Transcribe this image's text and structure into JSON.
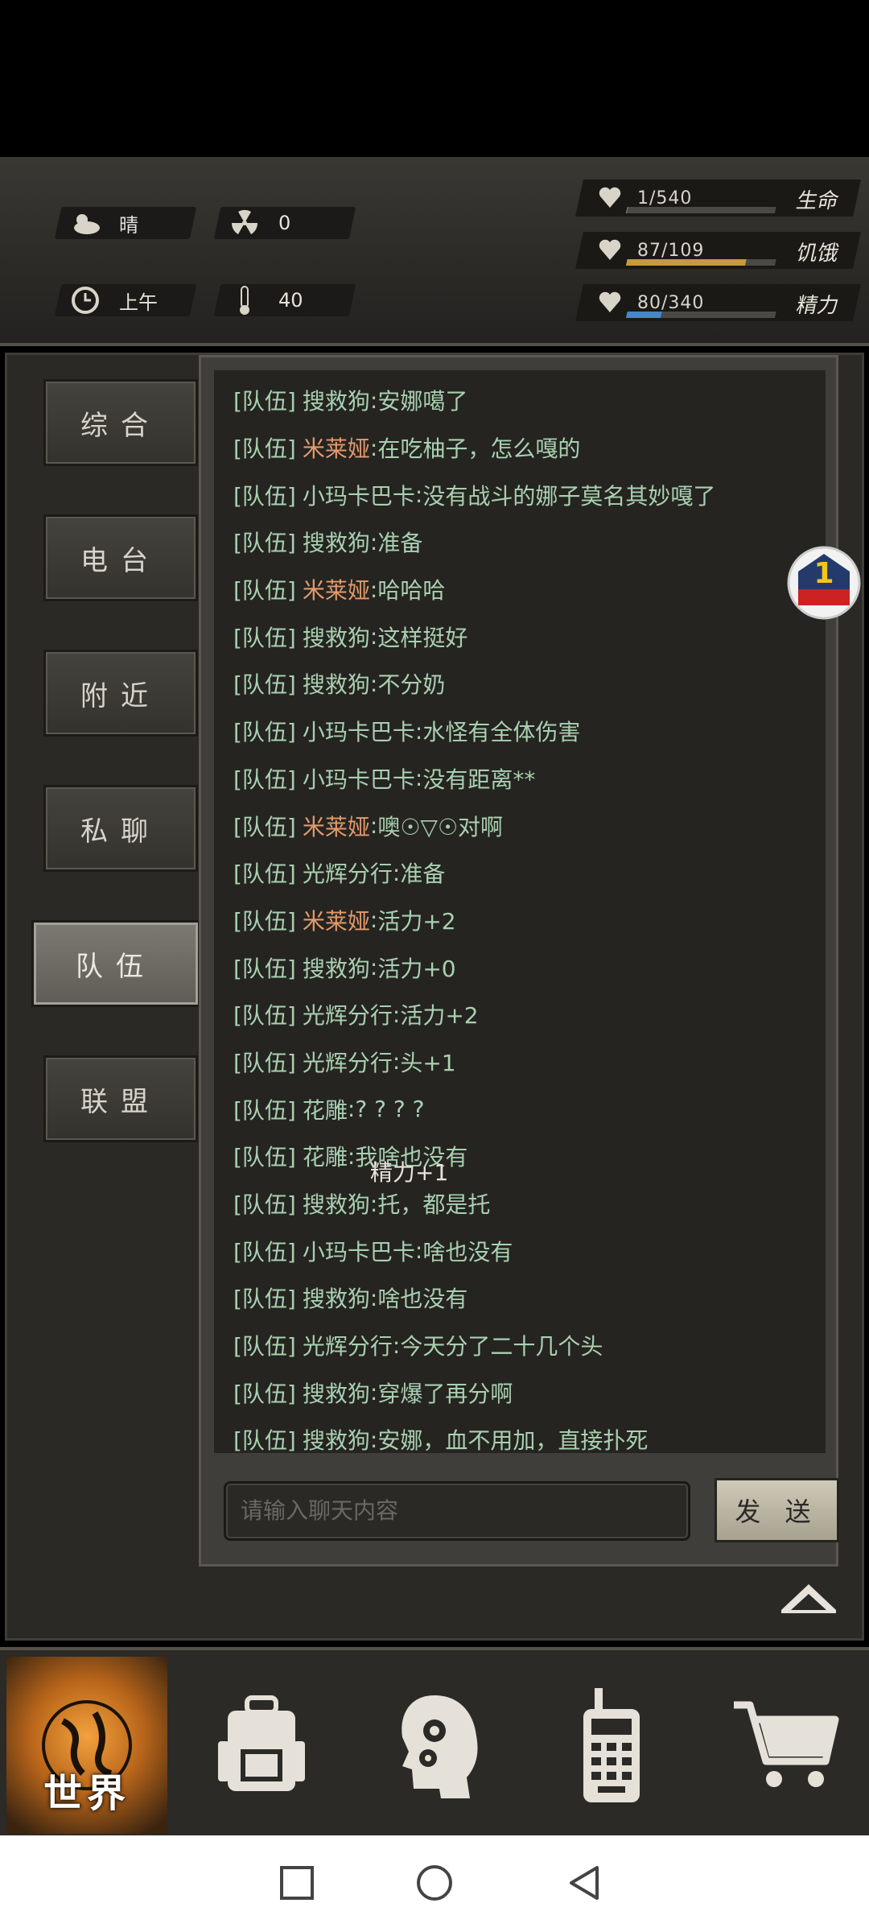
{
  "hud": {
    "weather": "晴",
    "radiation": "0",
    "time_of_day": "上午",
    "temperature": "40",
    "stats": [
      {
        "name": "生命",
        "value": "1/540",
        "fraction": 0.002,
        "color": "#8a8a85"
      },
      {
        "name": "饥饿",
        "value": "87/109",
        "fraction": 0.8,
        "color": "#c79a3f"
      },
      {
        "name": "精力",
        "value": "80/340",
        "fraction": 0.235,
        "color": "#4a86c8"
      }
    ]
  },
  "tabs": [
    {
      "label": "综合",
      "active": false
    },
    {
      "label": "电台",
      "active": false
    },
    {
      "label": "附近",
      "active": false
    },
    {
      "label": "私聊",
      "active": false
    },
    {
      "label": "队伍",
      "active": true
    },
    {
      "label": "联盟",
      "active": false
    }
  ],
  "chat": {
    "channel_prefix": "[队伍]",
    "messages": [
      {
        "who": "搜救狗",
        "text": "安娜噶了",
        "orange": false
      },
      {
        "who": "米莱娅",
        "text": "在吃柚子，怎么嘎的",
        "orange": true
      },
      {
        "who": "小玛卡巴卡",
        "text": "没有战斗的娜子莫名其妙嘎了",
        "orange": false
      },
      {
        "who": "搜救狗",
        "text": "准备",
        "orange": false
      },
      {
        "who": "米莱娅",
        "text": "哈哈哈",
        "orange": true
      },
      {
        "who": "搜救狗",
        "text": "这样挺好",
        "orange": false
      },
      {
        "who": "搜救狗",
        "text": "不分奶",
        "orange": false
      },
      {
        "who": "小玛卡巴卡",
        "text": "水怪有全体伤害",
        "orange": false
      },
      {
        "who": "小玛卡巴卡",
        "text": "没有距离**",
        "orange": false
      },
      {
        "who": "米莱娅",
        "text": "噢☉▽☉对啊",
        "orange": true
      },
      {
        "who": "光辉分行",
        "text": "准备",
        "orange": false
      },
      {
        "who": "米莱娅",
        "text": "活力+2",
        "orange": true
      },
      {
        "who": "搜救狗",
        "text": "活力+0",
        "orange": false
      },
      {
        "who": "光辉分行",
        "text": "活力+2",
        "orange": false
      },
      {
        "who": "光辉分行",
        "text": "头+1",
        "orange": false
      },
      {
        "who": "花雕",
        "text": "? ? ? ?",
        "orange": false
      },
      {
        "who": "花雕",
        "text": "我啥也没有",
        "orange": false
      },
      {
        "who": "搜救狗",
        "text": "托，都是托",
        "orange": false
      },
      {
        "who": "小玛卡巴卡",
        "text": "啥也没有",
        "orange": false
      },
      {
        "who": "搜救狗",
        "text": "啥也没有",
        "orange": false
      },
      {
        "who": "光辉分行",
        "text": "今天分了二十几个头",
        "orange": false
      },
      {
        "who": "搜救狗",
        "text": "穿爆了再分啊",
        "orange": false
      },
      {
        "who": "搜救狗",
        "text": "安娜，血不用加，直接扑死",
        "orange": false
      }
    ],
    "floating_text": "精力+1",
    "input_placeholder": "请输入聊天内容",
    "send_label": "发 送"
  },
  "badge_count": "1",
  "bottom_nav": {
    "world_label": "世界"
  }
}
